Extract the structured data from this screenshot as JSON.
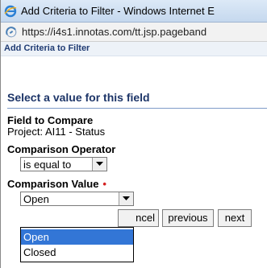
{
  "window": {
    "title": "Add Criteria to Filter - Windows Internet E"
  },
  "address_bar": {
    "url": "https://i4s1.innotas.com/tt.jsp.pageband"
  },
  "header": {
    "title": "Add Criteria to Filter"
  },
  "form": {
    "section_heading": "Select a value for this field",
    "field_to_compare": {
      "label": "Field to Compare",
      "value": "Project: AI11 - Status"
    },
    "comparison_operator": {
      "label": "Comparison Operator",
      "selected": "is equal to"
    },
    "comparison_value": {
      "label": "Comparison Value",
      "required_marker": "•",
      "selected": "Open",
      "options": [
        "Open",
        "Closed"
      ],
      "highlighted_option": "Open"
    }
  },
  "buttons": {
    "cancel_visible_text": "ncel",
    "previous": "previous",
    "next": "next"
  },
  "colors": {
    "heading": "#1d3568",
    "required": "#d42020",
    "highlight": "#3376d6"
  },
  "icons": {
    "title_icon": "internet-explorer-icon",
    "page_icon": "page-loading-icon",
    "select_arrow": "chevron-down-icon"
  }
}
